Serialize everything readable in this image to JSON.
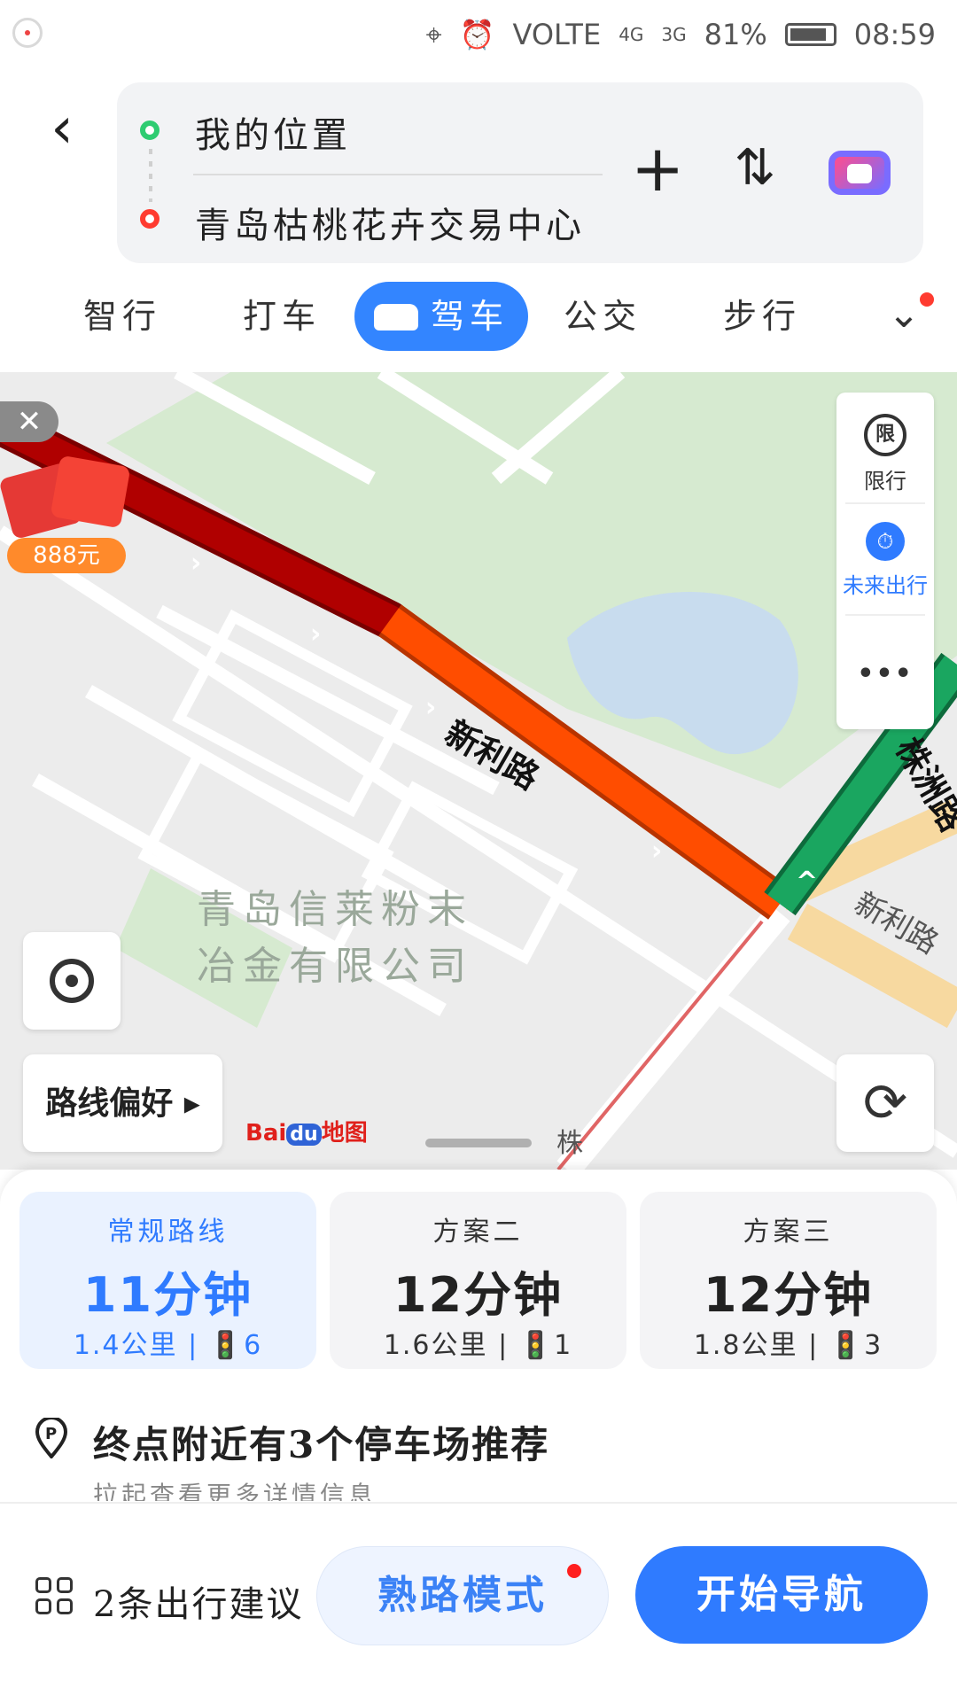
{
  "status_bar": {
    "volte": "VOLTE",
    "net1": "4G",
    "net2": "3G",
    "battery": "81%",
    "time": "08:59"
  },
  "header": {
    "start": "我的位置",
    "end": "青岛枯桃花卉交易中心"
  },
  "tabs": [
    {
      "label": "智行"
    },
    {
      "label": "打车"
    },
    {
      "label": "驾车"
    },
    {
      "label": "公交"
    },
    {
      "label": "步行"
    }
  ],
  "map": {
    "reward_amount": "888元",
    "road1": "新利路",
    "road2": "株洲路",
    "road3": "新利路",
    "road4": "株",
    "poi": "青岛信莱粉末冶金有限公司",
    "side_panel": {
      "limit_icon": "限",
      "limit": "限行",
      "future": "未来出行",
      "more": "•••"
    },
    "route_pref": "路线偏好 ▸",
    "baidu_prefix": "Bai",
    "baidu_du": "du",
    "baidu_suffix": "地图"
  },
  "routes": [
    {
      "name": "常规路线",
      "time": "11分钟",
      "distance": "1.4公里",
      "lights": "6"
    },
    {
      "name": "方案二",
      "time": "12分钟",
      "distance": "1.6公里",
      "lights": "1"
    },
    {
      "name": "方案三",
      "time": "12分钟",
      "distance": "1.8公里",
      "lights": "3"
    }
  ],
  "parking": {
    "title": "终点附近有3个停车场推荐",
    "subtitle": "拉起查看更多详情信息"
  },
  "footer": {
    "suggestions": "2条出行建议",
    "familiar_mode": "熟路模式",
    "start_nav": "开始导航"
  },
  "colors": {
    "accent": "#3385ff",
    "traffic_jam": "#b00000",
    "traffic_slow": "#ff4d00",
    "traffic_clear": "#1aa660"
  }
}
